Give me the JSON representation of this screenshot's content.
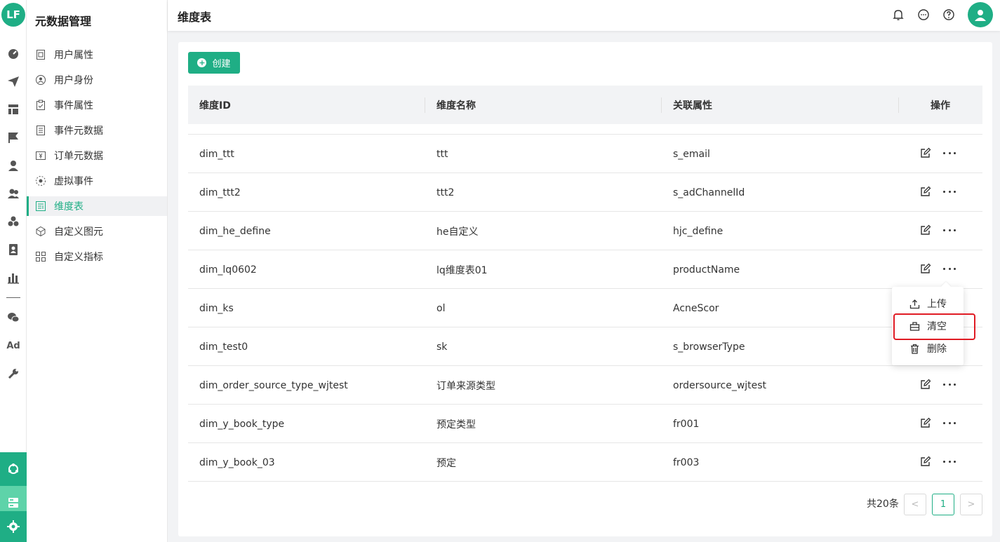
{
  "app": {
    "logo_text": "LF",
    "ad_label": "Ad"
  },
  "nav": {
    "title": "元数据管理",
    "items": [
      {
        "label": "用户属性",
        "icon": "user-attribute-icon"
      },
      {
        "label": "用户身份",
        "icon": "user-identity-icon"
      },
      {
        "label": "事件属性",
        "icon": "event-attribute-icon"
      },
      {
        "label": "事件元数据",
        "icon": "event-metadata-icon"
      },
      {
        "label": "订单元数据",
        "icon": "order-metadata-icon"
      },
      {
        "label": "虚拟事件",
        "icon": "virtual-event-icon"
      },
      {
        "label": "维度表",
        "icon": "dimension-table-icon",
        "active": true
      },
      {
        "label": "自定义图元",
        "icon": "custom-element-icon"
      },
      {
        "label": "自定义指标",
        "icon": "custom-metric-icon"
      }
    ]
  },
  "header": {
    "title": "维度表"
  },
  "toolbar": {
    "create_label": "创建"
  },
  "table": {
    "columns": [
      "维度ID",
      "维度名称",
      "关联属性",
      "操作"
    ],
    "rows": [
      {
        "id": "dim_ttt",
        "name": "ttt",
        "attr": "s_email"
      },
      {
        "id": "dim_ttt2",
        "name": "ttt2",
        "attr": "s_adChannelId"
      },
      {
        "id": "dim_he_define",
        "name": "he自定义",
        "attr": "hjc_define"
      },
      {
        "id": "dim_lq0602",
        "name": "lq维度表01",
        "attr": "productName"
      },
      {
        "id": "dim_ks",
        "name": "ol",
        "attr": "AcneScor"
      },
      {
        "id": "dim_test0",
        "name": "sk",
        "attr": "s_browserType"
      },
      {
        "id": "dim_order_source_type_wjtest",
        "name": "订单来源类型",
        "attr": "ordersource_wjtest"
      },
      {
        "id": "dim_y_book_type",
        "name": "预定类型",
        "attr": "fr001"
      },
      {
        "id": "dim_y_book_03",
        "name": "预定",
        "attr": "fr003"
      }
    ]
  },
  "dropdown": {
    "upload": "上传",
    "clear": "清空",
    "delete": "删除"
  },
  "pagination": {
    "total": "共20条",
    "current": "1",
    "prev": "<",
    "next": ">"
  },
  "colors": {
    "accent": "#1fae85",
    "highlight": "#e01b24"
  }
}
